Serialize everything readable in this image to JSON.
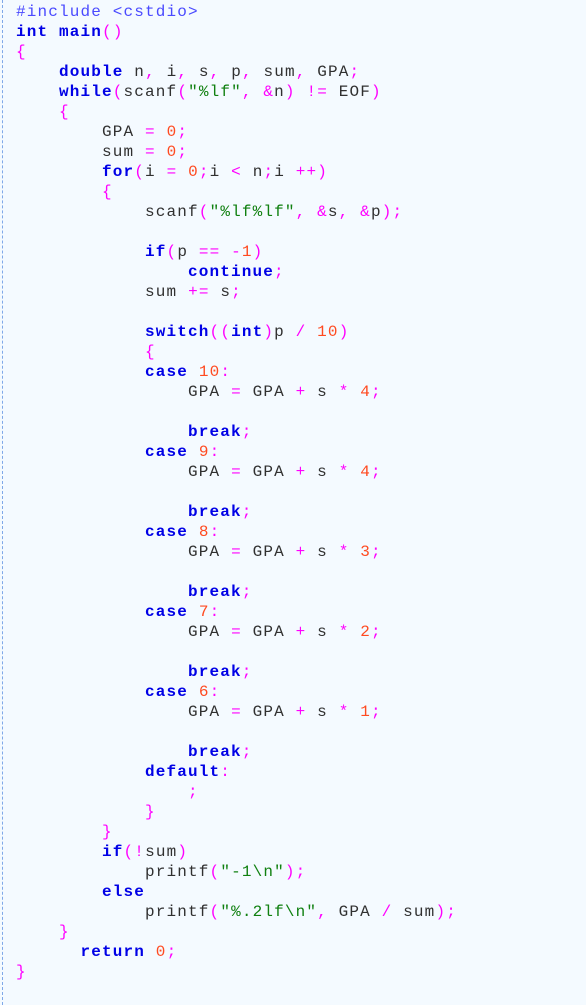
{
  "editor": {
    "lines": [
      "#include <cstdio>",
      "int main()",
      "{",
      "    double n, i, s, p, sum, GPA;",
      "    while(scanf(\"%lf\", &n) != EOF)",
      "    {",
      "        GPA = 0;",
      "        sum = 0;",
      "        for(i = 0;i < n;i ++)",
      "        {",
      "            scanf(\"%lf%lf\", &s, &p);",
      "",
      "            if(p == -1)",
      "                continue;",
      "            sum += s;",
      "",
      "            switch((int)p / 10)",
      "            {",
      "            case 10:",
      "                GPA = GPA + s * 4;",
      "",
      "                break;",
      "            case 9:",
      "                GPA = GPA + s * 4;",
      "",
      "                break;",
      "            case 8:",
      "                GPA = GPA + s * 3;",
      "",
      "                break;",
      "            case 7:",
      "                GPA = GPA + s * 2;",
      "",
      "                break;",
      "            case 6:",
      "                GPA = GPA + s * 1;",
      "",
      "                break;",
      "            default:",
      "                ;",
      "            }",
      "        }",
      "        if(!sum)",
      "            printf(\"-1\\n\");",
      "        else",
      "            printf(\"%.2lf\\n\", GPA / sum);",
      "    }",
      "      return 0;",
      "}"
    ]
  },
  "colors": {
    "background": "#f4faff",
    "keyword": "#0000e6",
    "operator": "#ff00ff",
    "number": "#ff4a20",
    "string": "#108010",
    "identifier": "#303030",
    "preprocessor": "#4a4aff"
  }
}
